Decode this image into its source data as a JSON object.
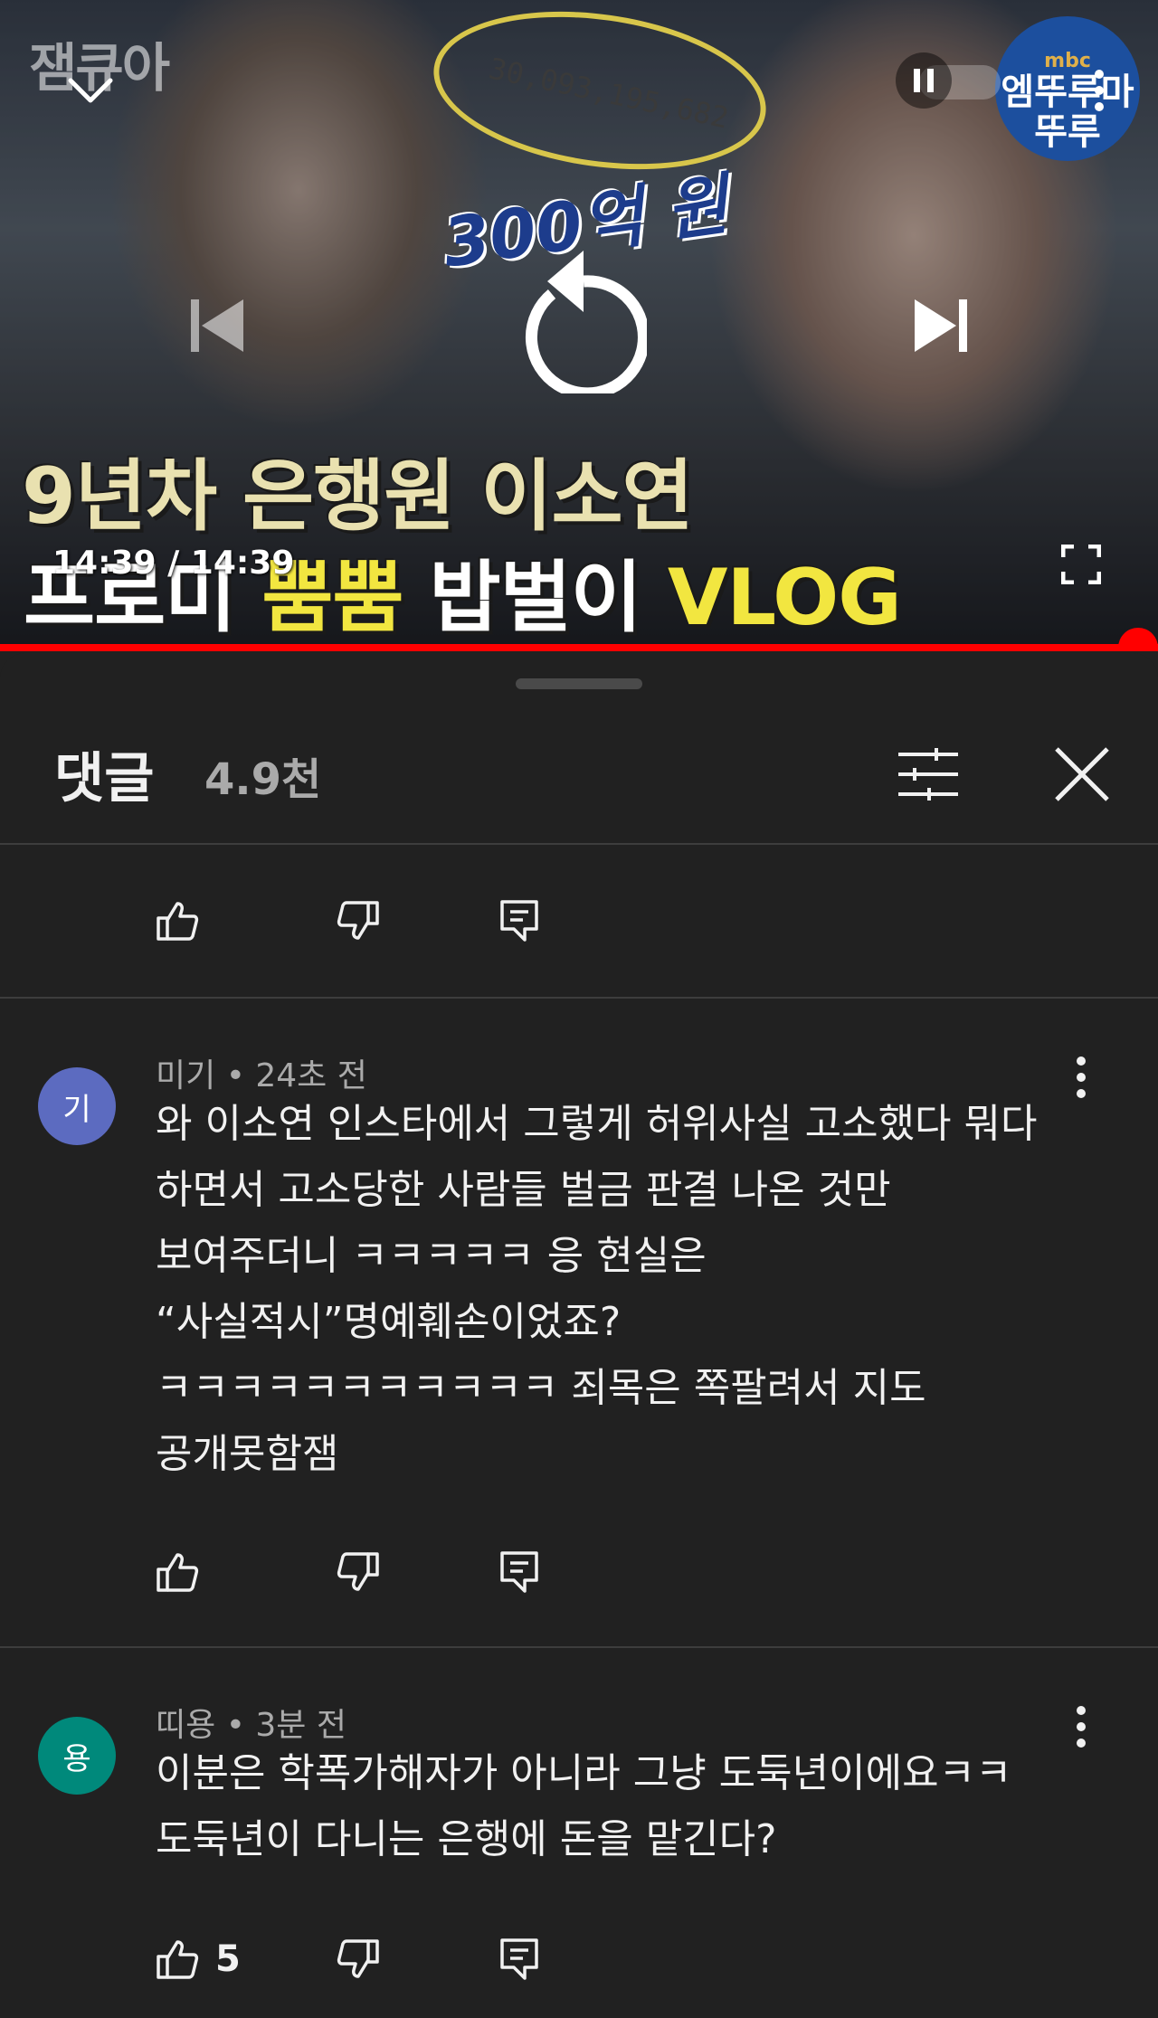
{
  "player": {
    "channel_watermark": "잼큐아",
    "amount_figure": "30,093,195,682",
    "amount_zero": "0",
    "amount_badge": "300억 원",
    "logo_small": "mbc",
    "logo_text": "엠뚜루마뚜루",
    "title_line1": "9년차 은행원 이소연",
    "title_line2_prefix": "프로미 ",
    "title_line2_highlight": "뿜뿜",
    "title_line2_suffix": " 밥벌이 ",
    "title_line2_highlight2": "VLOG",
    "time": "14:39 / 14:39",
    "progress_fraction": 1.0,
    "colors": {
      "progress": "#ff0000",
      "highlight": "#f2e640"
    }
  },
  "panel": {
    "title": "댓글",
    "count": "4.9천",
    "icons": {
      "filter": "sort-filter-icon",
      "close": "close-icon"
    }
  },
  "comments": [
    {
      "avatar_letter": "기",
      "avatar_color": "#5c6bc0",
      "author": "미기",
      "time": "24초 전",
      "body": "와 이소연 인스타에서 그렇게 허위사실 고소했다 뭐다\n하면서 고소당한 사람들 벌금 판결 나온 것만\n보여주더니 ㅋㅋㅋㅋㅋ 응 현실은\n“사실적시”명예훼손이었죠?\nㅋㅋㅋㅋㅋㅋㅋㅋㅋㅋㅋ 죄목은 쪽팔려서 지도\n공개못함잼",
      "likes": ""
    },
    {
      "avatar_letter": "용",
      "avatar_color": "#00897b",
      "author": "띠용",
      "time": "3분 전",
      "body": "이분은 학폭가해자가 아니라 그냥 도둑년이에요ㅋㅋ\n도둑년이 다니는 은행에 돈을 맡긴다?",
      "likes": "5"
    }
  ]
}
